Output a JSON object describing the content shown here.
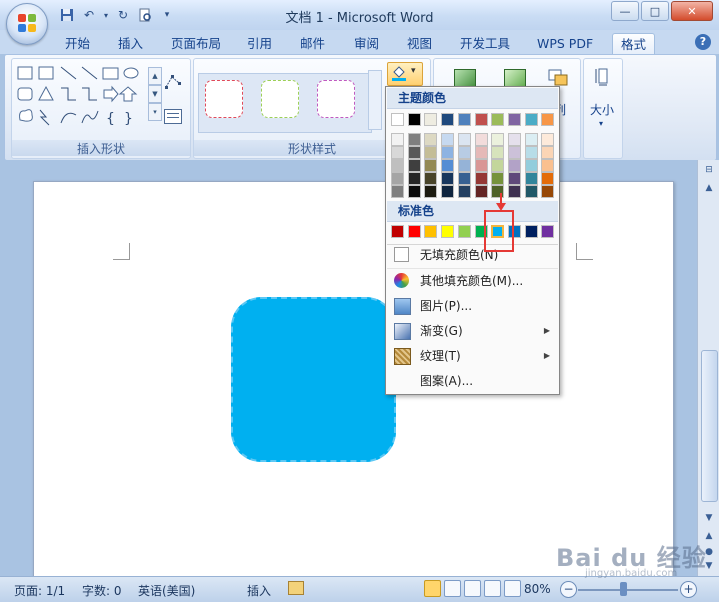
{
  "window": {
    "title": "文档 1 - Microsoft Word",
    "minimize": "—",
    "maximize": "□",
    "close": "✕"
  },
  "quick_access": {
    "icons": [
      "save-icon",
      "undo-icon",
      "redo-icon",
      "print-preview-icon",
      "customize-icon"
    ]
  },
  "ribbon": {
    "tabs": [
      {
        "label": "开始"
      },
      {
        "label": "插入"
      },
      {
        "label": "页面布局"
      },
      {
        "label": "引用"
      },
      {
        "label": "邮件"
      },
      {
        "label": "审阅"
      },
      {
        "label": "视图"
      },
      {
        "label": "开发工具"
      },
      {
        "label": "WPS PDF"
      },
      {
        "label": "格式"
      }
    ],
    "active_tab": "格式",
    "groups": {
      "insert_shapes": "插入形状",
      "shape_styles": "形状样式",
      "size": "大小",
      "partial_label": "列"
    },
    "style_colors": [
      "#e04a5a",
      "#9ccf57",
      "#c05ac0"
    ]
  },
  "fill_dropdown": {
    "theme_header": "主题颜色",
    "standard_header": "标准色",
    "theme_top_row": [
      "#ffffff",
      "#000000",
      "#eeece1",
      "#1f497d",
      "#4f81bd",
      "#c0504d",
      "#9bbb59",
      "#8064a2",
      "#4bacc6",
      "#f79646"
    ],
    "theme_columns": [
      [
        "#f2f2f2",
        "#d8d8d8",
        "#bfbfbf",
        "#a5a5a5",
        "#7f7f7f"
      ],
      [
        "#7f7f7f",
        "#595959",
        "#3f3f3f",
        "#262626",
        "#0c0c0c"
      ],
      [
        "#ddd9c3",
        "#c4bd97",
        "#938953",
        "#494429",
        "#1d1b10"
      ],
      [
        "#c6d9f0",
        "#8db3e2",
        "#548dd4",
        "#17365d",
        "#0f243e"
      ],
      [
        "#dbe5f1",
        "#b8cce4",
        "#95b3d7",
        "#366092",
        "#244061"
      ],
      [
        "#f2dcdb",
        "#e5b9b7",
        "#d99694",
        "#953734",
        "#632423"
      ],
      [
        "#ebf1dd",
        "#d7e3bc",
        "#c3d69b",
        "#76923c",
        "#4f6128"
      ],
      [
        "#e5e0ec",
        "#ccc1d9",
        "#b2a2c7",
        "#5f497a",
        "#3f3151"
      ],
      [
        "#dbeef3",
        "#b7dde8",
        "#92cddc",
        "#31859b",
        "#205867"
      ],
      [
        "#fdeada",
        "#fbd5b5",
        "#fac08f",
        "#e36c09",
        "#974806"
      ]
    ],
    "standard_colors": [
      "#c00000",
      "#ff0000",
      "#ffc000",
      "#ffff00",
      "#92d050",
      "#00b050",
      "#00b0f0",
      "#0070c0",
      "#002060",
      "#7030a0"
    ],
    "selected_standard_color": "#00b0f0",
    "menu": [
      {
        "label": "无填充颜色(N)",
        "icon": "no-fill-icon"
      },
      {
        "label": "其他填充颜色(M)...",
        "icon": "more-colors-icon"
      },
      {
        "label": "图片(P)...",
        "icon": "picture-icon"
      },
      {
        "label": "渐变(G)",
        "icon": "gradient-icon",
        "submenu": true
      },
      {
        "label": "纹理(T)",
        "icon": "texture-icon",
        "submenu": true
      },
      {
        "label": "图案(A)...",
        "icon": "pattern-icon"
      }
    ]
  },
  "document": {
    "shape_fill": "#00b0f0",
    "shape_border": "#5ec8f4"
  },
  "statusbar": {
    "page": "页面: 1/1",
    "words": "字数: 0",
    "language": "英语(美国)",
    "mode": "插入",
    "zoom": "80%"
  },
  "watermark": {
    "brand": "Bai du 经验",
    "url": "jingyan.baidu.com"
  }
}
